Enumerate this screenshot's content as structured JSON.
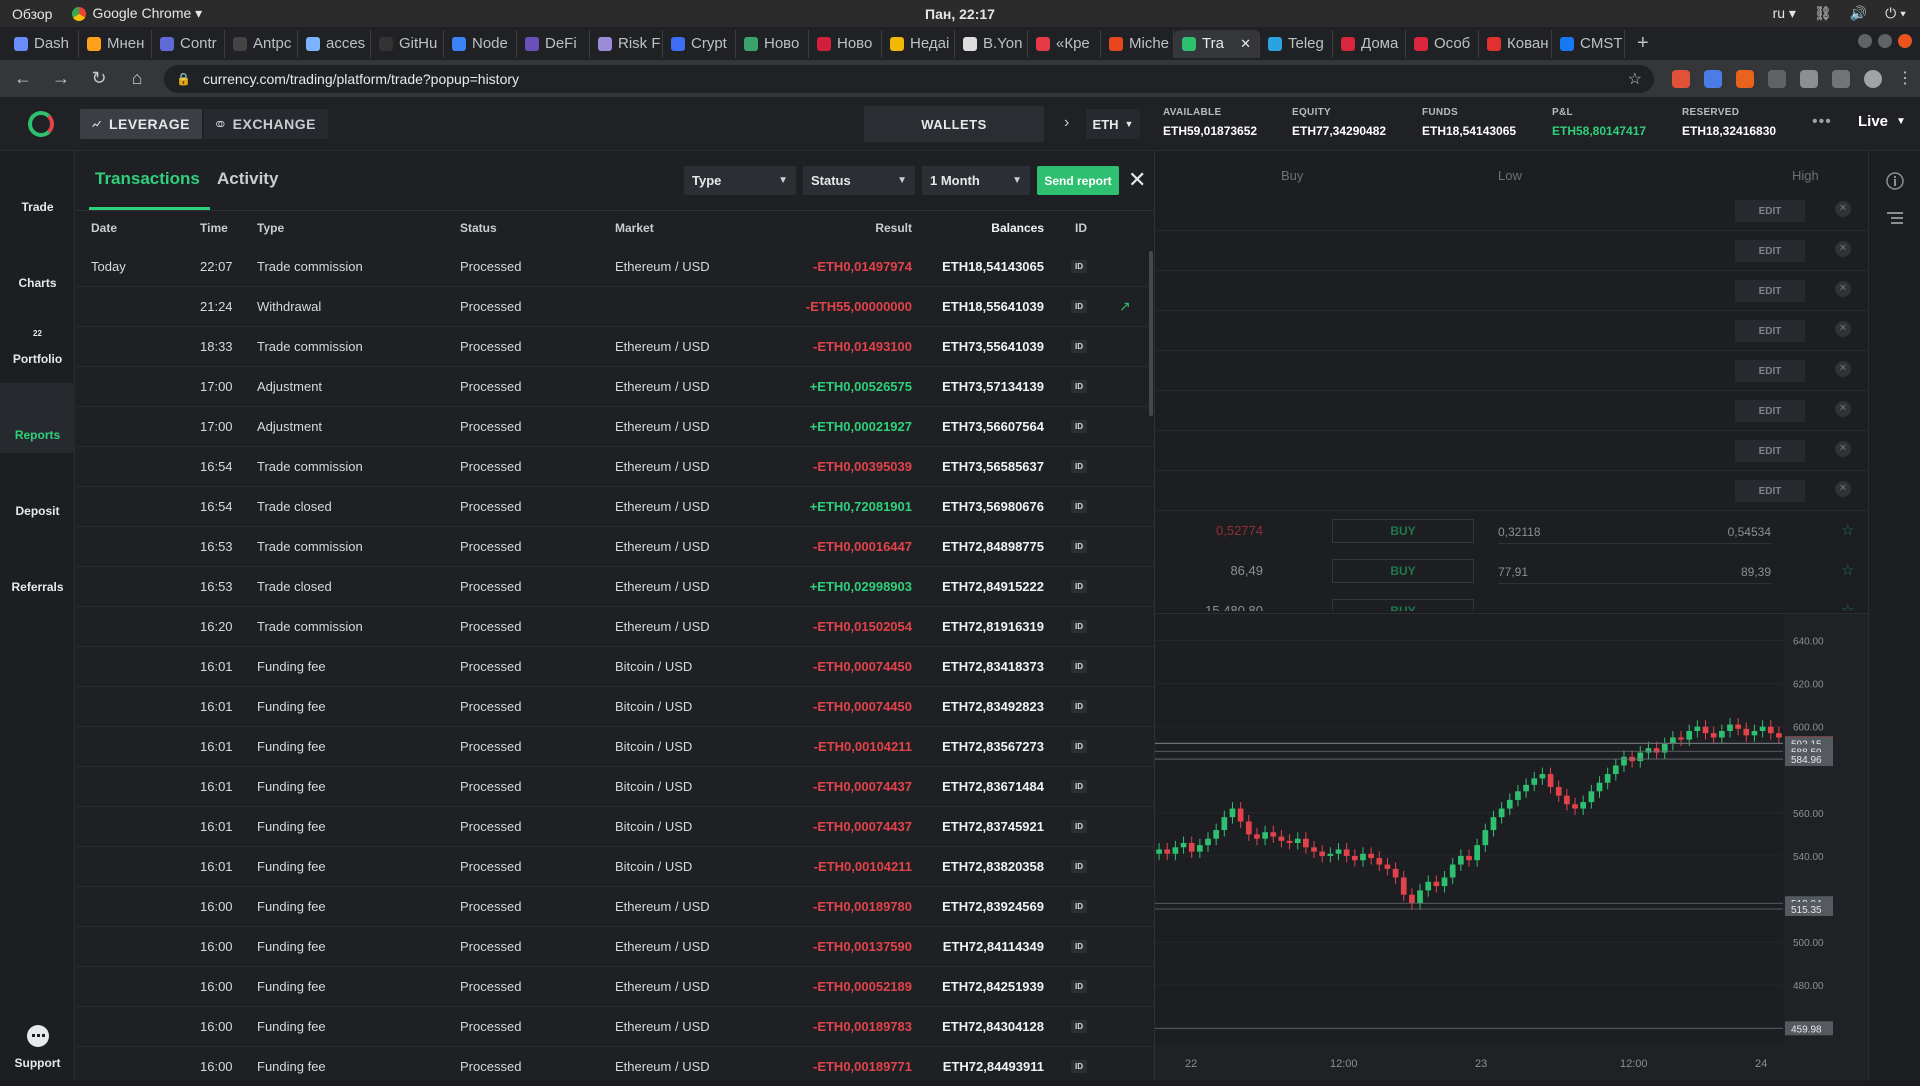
{
  "os": {
    "activities": "Обзор",
    "app": "Google Chrome",
    "clock": "Пан, 22:17",
    "lang": "ru"
  },
  "browser": {
    "tabs": [
      {
        "label": "Dash",
        "color": "#6a8cff"
      },
      {
        "label": "Мнен",
        "color": "#ff9f1a"
      },
      {
        "label": "Contr",
        "color": "#5f6ad6"
      },
      {
        "label": "Antpc",
        "color": "#444444"
      },
      {
        "label": "acces",
        "color": "#7ab3ff"
      },
      {
        "label": "GitHu",
        "color": "#333333"
      },
      {
        "label": "Node",
        "color": "#3b82f6"
      },
      {
        "label": "DeFi",
        "color": "#6b4fbb"
      },
      {
        "label": "Risk F",
        "color": "#9b8bd6"
      },
      {
        "label": "Crypt",
        "color": "#3d6df2"
      },
      {
        "label": "Ново",
        "color": "#3aa36b"
      },
      {
        "label": "Ново",
        "color": "#d21f3c"
      },
      {
        "label": "Недаі",
        "color": "#f2b705"
      },
      {
        "label": "B.Yon",
        "color": "#dddddd"
      },
      {
        "label": "«Кре",
        "color": "#e63946"
      },
      {
        "label": "Miche",
        "color": "#e8461e"
      },
      {
        "label": "Tra",
        "color": "#2fbf71",
        "active": true
      },
      {
        "label": "Teleg",
        "color": "#2aa3e0"
      },
      {
        "label": "Дома",
        "color": "#d7263d"
      },
      {
        "label": "Особ",
        "color": "#d7263d"
      },
      {
        "label": "Кован",
        "color": "#e03030"
      },
      {
        "label": "CMST",
        "color": "#1877f2"
      }
    ],
    "tab_close": "✕",
    "new_tab": "+",
    "url": "currency.com/trading/platform/trade?popup=history"
  },
  "header": {
    "leverage": "LEVERAGE",
    "exchange": "EXCHANGE",
    "wallets": "WALLETS",
    "currency": "ETH",
    "stats": [
      {
        "label": "AVAILABLE",
        "value": "ETH59,01873652",
        "green": false
      },
      {
        "label": "EQUITY",
        "value": "ETH77,34290482",
        "green": false
      },
      {
        "label": "FUNDS",
        "value": "ETH18,54143065",
        "green": false
      },
      {
        "label": "P&L",
        "value": "ETH58,80147417",
        "green": true
      },
      {
        "label": "RESERVED",
        "value": "ETH18,32416830",
        "green": false
      }
    ],
    "more": "•••",
    "live": "Live"
  },
  "sidebar": {
    "items": [
      {
        "label": "Trade",
        "icon": "trade-icon"
      },
      {
        "label": "Charts",
        "icon": "charts-icon"
      },
      {
        "label": "Portfolio",
        "icon": "portfolio-icon"
      },
      {
        "label": "Reports",
        "icon": "reports-icon",
        "active": true
      },
      {
        "label": "Deposit",
        "icon": "deposit-icon"
      },
      {
        "label": "Referrals",
        "icon": "referrals-icon"
      }
    ],
    "support": "Support",
    "portfolio_badge": "22"
  },
  "panel": {
    "tab_transactions": "Transactions",
    "tab_activity": "Activity",
    "filter_type": "Type",
    "filter_status": "Status",
    "filter_period": "1 Month",
    "send_report": "Send report",
    "close": "✕",
    "columns": {
      "date": "Date",
      "time": "Time",
      "type": "Type",
      "status": "Status",
      "market": "Market",
      "result": "Result",
      "balances": "Balances",
      "id": "ID"
    },
    "id_badge": "ID",
    "rows": [
      {
        "date": "Today",
        "time": "22:07",
        "type": "Trade commission",
        "status": "Processed",
        "market": "Ethereum / USD",
        "result": "-ETH0,01497974",
        "balance": "ETH18,54143065"
      },
      {
        "date": "",
        "time": "21:24",
        "type": "Withdrawal",
        "status": "Processed",
        "market": "",
        "result": "-ETH55,00000000",
        "balance": "ETH18,55641039",
        "link": true
      },
      {
        "date": "",
        "time": "18:33",
        "type": "Trade commission",
        "status": "Processed",
        "market": "Ethereum / USD",
        "result": "-ETH0,01493100",
        "balance": "ETH73,55641039"
      },
      {
        "date": "",
        "time": "17:00",
        "type": "Adjustment",
        "status": "Processed",
        "market": "Ethereum / USD",
        "result": "+ETH0,00526575",
        "balance": "ETH73,57134139"
      },
      {
        "date": "",
        "time": "17:00",
        "type": "Adjustment",
        "status": "Processed",
        "market": "Ethereum / USD",
        "result": "+ETH0,00021927",
        "balance": "ETH73,56607564"
      },
      {
        "date": "",
        "time": "16:54",
        "type": "Trade commission",
        "status": "Processed",
        "market": "Ethereum / USD",
        "result": "-ETH0,00395039",
        "balance": "ETH73,56585637"
      },
      {
        "date": "",
        "time": "16:54",
        "type": "Trade closed",
        "status": "Processed",
        "market": "Ethereum / USD",
        "result": "+ETH0,72081901",
        "balance": "ETH73,56980676"
      },
      {
        "date": "",
        "time": "16:53",
        "type": "Trade commission",
        "status": "Processed",
        "market": "Ethereum / USD",
        "result": "-ETH0,00016447",
        "balance": "ETH72,84898775"
      },
      {
        "date": "",
        "time": "16:53",
        "type": "Trade closed",
        "status": "Processed",
        "market": "Ethereum / USD",
        "result": "+ETH0,02998903",
        "balance": "ETH72,84915222"
      },
      {
        "date": "",
        "time": "16:20",
        "type": "Trade commission",
        "status": "Processed",
        "market": "Ethereum / USD",
        "result": "-ETH0,01502054",
        "balance": "ETH72,81916319"
      },
      {
        "date": "",
        "time": "16:01",
        "type": "Funding fee",
        "status": "Processed",
        "market": "Bitcoin / USD",
        "result": "-ETH0,00074450",
        "balance": "ETH72,83418373"
      },
      {
        "date": "",
        "time": "16:01",
        "type": "Funding fee",
        "status": "Processed",
        "market": "Bitcoin / USD",
        "result": "-ETH0,00074450",
        "balance": "ETH72,83492823"
      },
      {
        "date": "",
        "time": "16:01",
        "type": "Funding fee",
        "status": "Processed",
        "market": "Bitcoin / USD",
        "result": "-ETH0,00104211",
        "balance": "ETH72,83567273"
      },
      {
        "date": "",
        "time": "16:01",
        "type": "Funding fee",
        "status": "Processed",
        "market": "Bitcoin / USD",
        "result": "-ETH0,00074437",
        "balance": "ETH72,83671484"
      },
      {
        "date": "",
        "time": "16:01",
        "type": "Funding fee",
        "status": "Processed",
        "market": "Bitcoin / USD",
        "result": "-ETH0,00074437",
        "balance": "ETH72,83745921"
      },
      {
        "date": "",
        "time": "16:01",
        "type": "Funding fee",
        "status": "Processed",
        "market": "Bitcoin / USD",
        "result": "-ETH0,00104211",
        "balance": "ETH72,83820358"
      },
      {
        "date": "",
        "time": "16:00",
        "type": "Funding fee",
        "status": "Processed",
        "market": "Ethereum / USD",
        "result": "-ETH0,00189780",
        "balance": "ETH72,83924569"
      },
      {
        "date": "",
        "time": "16:00",
        "type": "Funding fee",
        "status": "Processed",
        "market": "Ethereum / USD",
        "result": "-ETH0,00137590",
        "balance": "ETH72,84114349"
      },
      {
        "date": "",
        "time": "16:00",
        "type": "Funding fee",
        "status": "Processed",
        "market": "Ethereum / USD",
        "result": "-ETH0,00052189",
        "balance": "ETH72,84251939"
      },
      {
        "date": "",
        "time": "16:00",
        "type": "Funding fee",
        "status": "Processed",
        "market": "Ethereum / USD",
        "result": "-ETH0,00189783",
        "balance": "ETH72,84304128"
      },
      {
        "date": "",
        "time": "16:00",
        "type": "Funding fee",
        "status": "Processed",
        "market": "Ethereum / USD",
        "result": "-ETH0,00189771",
        "balance": "ETH72,84493911"
      }
    ]
  },
  "trade": {
    "col_buy": "Buy",
    "col_low": "Low",
    "col_high": "High",
    "edit_label": "EDIT",
    "edit_rows": 8,
    "quotes": [
      {
        "price": "0,52774",
        "price_neg": true,
        "buy": "BUY",
        "low": "0,32118",
        "high": "0,54534"
      },
      {
        "price": "86,49",
        "price_neg": false,
        "buy": "BUY",
        "low": "77,91",
        "high": "89,39"
      },
      {
        "price": "15 480,80",
        "price_neg": false,
        "buy": "BUY",
        "low": "",
        "high": ""
      }
    ]
  },
  "chart_data": {
    "type": "candlestick",
    "y_ticks": [
      "640.00",
      "620.00",
      "600.00",
      "560.00",
      "540.00",
      "500.00",
      "480.00",
      "460.00"
    ],
    "price_tags": [
      {
        "value": 592.34,
        "label": "592.34",
        "color": "#c0392b"
      },
      {
        "value": 592.15,
        "label": "592.15",
        "color": "#555a60"
      },
      {
        "value": 588.59,
        "label": "588.59",
        "color": "#555a60"
      },
      {
        "value": 584.96,
        "label": "584.96",
        "color": "#555a60"
      },
      {
        "value": 518.04,
        "label": "518.04",
        "color": "#555a60"
      },
      {
        "value": 515.35,
        "label": "515.35",
        "color": "#555a60"
      },
      {
        "value": 459.98,
        "label": "459.98",
        "color": "#555a60"
      }
    ],
    "x_labels": [
      "22",
      "12:00",
      "23",
      "12:00",
      "24"
    ],
    "ylim": [
      455,
      650
    ],
    "closes": [
      543,
      541,
      544,
      546,
      542,
      545,
      548,
      552,
      558,
      562,
      556,
      550,
      548,
      551,
      549,
      547,
      546,
      548,
      544,
      542,
      540,
      541,
      543,
      540,
      538,
      541,
      539,
      536,
      534,
      530,
      522,
      518,
      524,
      528,
      526,
      530,
      536,
      540,
      538,
      545,
      552,
      558,
      562,
      566,
      570,
      573,
      576,
      578,
      572,
      568,
      564,
      562,
      565,
      570,
      574,
      578,
      582,
      586,
      584,
      588,
      590,
      588,
      592,
      595,
      594,
      598,
      600,
      597,
      595,
      598,
      601,
      599,
      596,
      598,
      600,
      597,
      595
    ]
  }
}
